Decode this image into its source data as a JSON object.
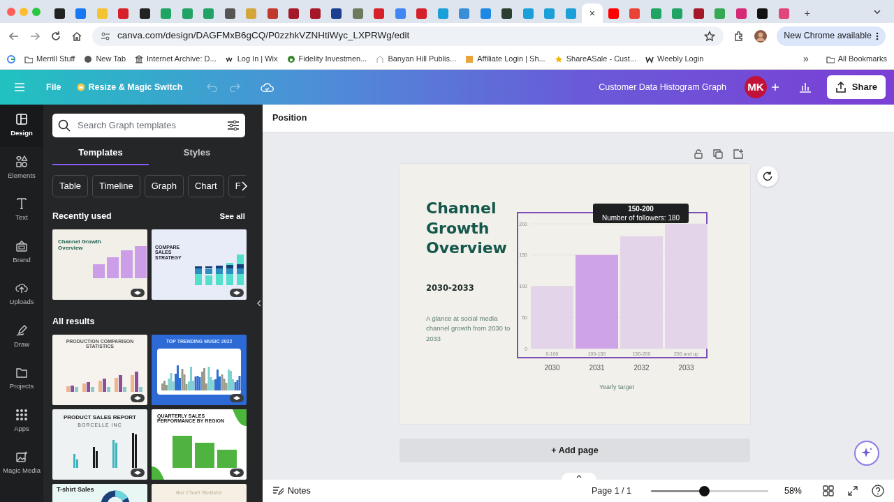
{
  "browser": {
    "tabs": [
      {
        "color": "#222222",
        "selected": false
      },
      {
        "color": "#1877f2",
        "selected": false
      },
      {
        "color": "#f4c430",
        "selected": false
      },
      {
        "color": "#d6202a",
        "selected": false
      },
      {
        "color": "#222222",
        "selected": false
      },
      {
        "color": "#1fa463",
        "selected": false
      },
      {
        "color": "#21a366",
        "selected": false
      },
      {
        "color": "#21a366",
        "selected": false
      },
      {
        "color": "#555555",
        "selected": false
      },
      {
        "color": "#d4a53a",
        "selected": false
      },
      {
        "color": "#c0392b",
        "selected": false
      },
      {
        "color": "#a5182a",
        "selected": false
      },
      {
        "color": "#a5182a",
        "selected": false
      },
      {
        "color": "#1d3f8f",
        "selected": false
      },
      {
        "color": "#6b7b5b",
        "selected": false
      },
      {
        "color": "#d6202a",
        "selected": false
      },
      {
        "color": "#4285f4",
        "selected": false
      },
      {
        "color": "#d6202a",
        "selected": false
      },
      {
        "color": "#1b9fd8",
        "selected": false
      },
      {
        "color": "#3a8ed8",
        "selected": false
      },
      {
        "color": "#1e88e5",
        "selected": false
      },
      {
        "color": "#2c3e2f",
        "selected": false
      },
      {
        "color": "#1b9fd8",
        "selected": false
      },
      {
        "color": "#1b9fd8",
        "selected": false
      },
      {
        "color": "#1b9fd8",
        "selected": false
      },
      {
        "selected": true,
        "close": "×"
      },
      {
        "color": "#ff0000",
        "selected": false
      },
      {
        "color": "#ea4335",
        "selected": false
      },
      {
        "color": "#1fa463",
        "selected": false
      },
      {
        "color": "#21a366",
        "selected": false
      },
      {
        "color": "#a5182a",
        "selected": false
      },
      {
        "color": "#34a853",
        "selected": false
      },
      {
        "color": "#d62976",
        "selected": false
      },
      {
        "color": "#111111",
        "selected": false
      },
      {
        "color": "#e0457b",
        "selected": false
      }
    ],
    "new_tab": "+",
    "url": "canva.com/design/DAGFMxB6gCQ/P0zzhkVZNHtiWyc_LXPRWg/edit",
    "update_button": "New Chrome available",
    "bookmarks": [
      "Merrill Stuff",
      "New Tab",
      "Internet Archive: D...",
      "Log In | Wix",
      "Fidelity Investmen...",
      "Banyan Hill Publis...",
      "Affiliate Login | Sh...",
      "ShareASale - Cust...",
      "Weebly Login"
    ],
    "more_bookmarks": "»",
    "all_bookmarks": "All Bookmarks"
  },
  "header": {
    "file": "File",
    "resize": "Resize & Magic Switch",
    "undo_disabled": true,
    "title": "Customer Data Histogram Graph",
    "avatar": "MK",
    "share": "Share"
  },
  "rail": [
    {
      "label": "Design",
      "selected": true
    },
    {
      "label": "Elements",
      "selected": false
    },
    {
      "label": "Text",
      "selected": false
    },
    {
      "label": "Brand",
      "selected": false
    },
    {
      "label": "Uploads",
      "selected": false
    },
    {
      "label": "Draw",
      "selected": false
    },
    {
      "label": "Projects",
      "selected": false
    },
    {
      "label": "Apps",
      "selected": false
    },
    {
      "label": "Magic Media",
      "selected": false
    }
  ],
  "panel": {
    "search": {
      "placeholder": "Search Graph templates"
    },
    "tabs": [
      {
        "label": "Templates",
        "selected": true
      },
      {
        "label": "Styles",
        "selected": false
      }
    ],
    "chips": [
      "Table",
      "Timeline",
      "Graph",
      "Chart",
      "F"
    ],
    "recent_heading": "Recently used",
    "see_all": "See all",
    "recent": [
      {
        "kind": "purple-bars",
        "title": "Channel Growth Overview"
      },
      {
        "kind": "stacked",
        "title": "COMPARE SALES STRATEGY"
      }
    ],
    "all_heading": "All results",
    "results": [
      {
        "kind": "grouped",
        "title": "PRODUCTION COMPARISON STATISTICS"
      },
      {
        "kind": "music",
        "title": "TOP TRENDING MUSIC 2022"
      },
      {
        "kind": "sales",
        "title": "PRODUCT SALES REPORT",
        "subtitle": "BORCELLE INC"
      },
      {
        "kind": "green",
        "title": "QUARTERLY SALES PERFORMANCE BY REGION"
      },
      {
        "kind": "donut",
        "title": "T-shirt Sales"
      },
      {
        "kind": "plain",
        "title": "Bar Chart Statistic"
      }
    ]
  },
  "toolbar": {
    "label": "Position"
  },
  "slide": {
    "title": "Channel Growth Overview",
    "years": "2030-2033",
    "description": "A glance at social media channel growth from 2030 to 2033",
    "chart": {
      "chart_data": {
        "type": "bar",
        "categories": [
          "0-100",
          "100-150",
          "150-200",
          "200 and up"
        ],
        "values": [
          100,
          150,
          180,
          200
        ],
        "xlabel": "Yearly target",
        "ylim": [
          0,
          200
        ],
        "grid": true,
        "yticks": [
          0,
          50,
          100,
          150,
          200
        ]
      },
      "bars": [
        {
          "selected": false
        },
        {
          "selected": true
        },
        {
          "selected": false
        },
        {
          "selected": false
        }
      ],
      "year_labels": [
        "2030",
        "2031",
        "2032",
        "2033"
      ],
      "tooltip": {
        "title": "150-200",
        "text": "Number of followers: 180"
      }
    }
  },
  "add_page": "+ Add page",
  "footer": {
    "notes": "Notes",
    "page": "Page 1 / 1",
    "zoom": {
      "level": 0.45
    },
    "zoom_text": "58%"
  }
}
